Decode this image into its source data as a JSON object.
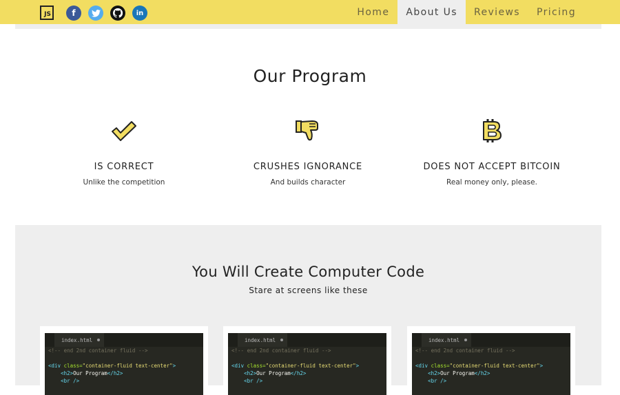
{
  "navbar": {
    "brand": "JS",
    "social": [
      "facebook-icon",
      "twitter-icon",
      "github-icon",
      "linkedin-icon"
    ],
    "links": [
      {
        "label": "Home",
        "active": false
      },
      {
        "label": "About Us",
        "active": true
      },
      {
        "label": "Reviews",
        "active": false
      },
      {
        "label": "Pricing",
        "active": false
      }
    ]
  },
  "program": {
    "title": "Our Program",
    "features": [
      {
        "icon": "checkmark-icon",
        "title": "IS CORRECT",
        "subtitle": "Unlike the competition"
      },
      {
        "icon": "thumbs-down-icon",
        "title": "CRUSHES IGNORANCE",
        "subtitle": "And builds character"
      },
      {
        "icon": "bitcoin-icon",
        "title": "DOES NOT ACCEPT BITCOIN",
        "subtitle": "Real money only, please."
      }
    ]
  },
  "code_section": {
    "title": "You Will Create Computer Code",
    "subtitle": "Stare at screens like these",
    "editor": {
      "tab": "index.html",
      "line1": "<!-- end 2nd container fluid -->",
      "line3_tag_open": "<div ",
      "line3_attr": "class=",
      "line3_str": "\"container-fluid text-center\"",
      "line3_close": ">",
      "line4_open": "<h2>",
      "line4_text": "Our Program",
      "line4_close": "</h2>",
      "line5": "<br />"
    }
  },
  "colors": {
    "accent": "#f2dd61",
    "section_gray": "#eeeeee"
  }
}
